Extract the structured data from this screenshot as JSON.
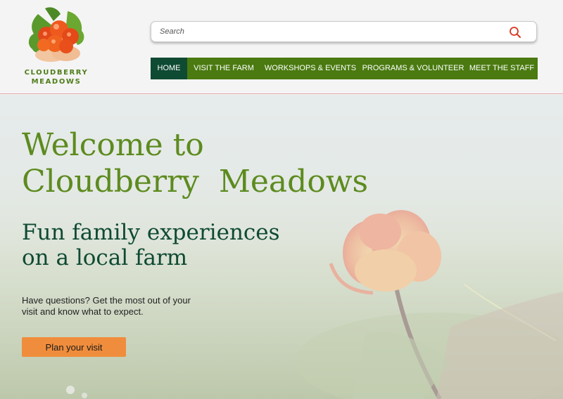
{
  "brand": {
    "line1": "CLOUDBERRY",
    "line2": "MEADOWS",
    "logo_icon": "cloudberry-logo-icon"
  },
  "search": {
    "placeholder": "Search",
    "icon": "search-icon"
  },
  "nav": {
    "items": [
      "HOME",
      "VISIT THE FARM",
      "WORKSHOPS & EVENTS",
      "PROGRAMS & VOLUNTEER",
      "MEET THE STAFF"
    ],
    "active": "HOME"
  },
  "hero": {
    "title": "Welcome to\nCloudberry  Meadows",
    "subtitle": "Fun family experiences\non a local farm",
    "blurb": "Have questions? Get the most out of your visit and know what to expect.",
    "cta": "Plan your visit"
  },
  "colors": {
    "brand_green": "#5d8b1f",
    "nav_green": "#4a7a10",
    "nav_active": "#0f4a32",
    "cta_orange": "#f08d3c",
    "search_icon": "#d8341e"
  }
}
